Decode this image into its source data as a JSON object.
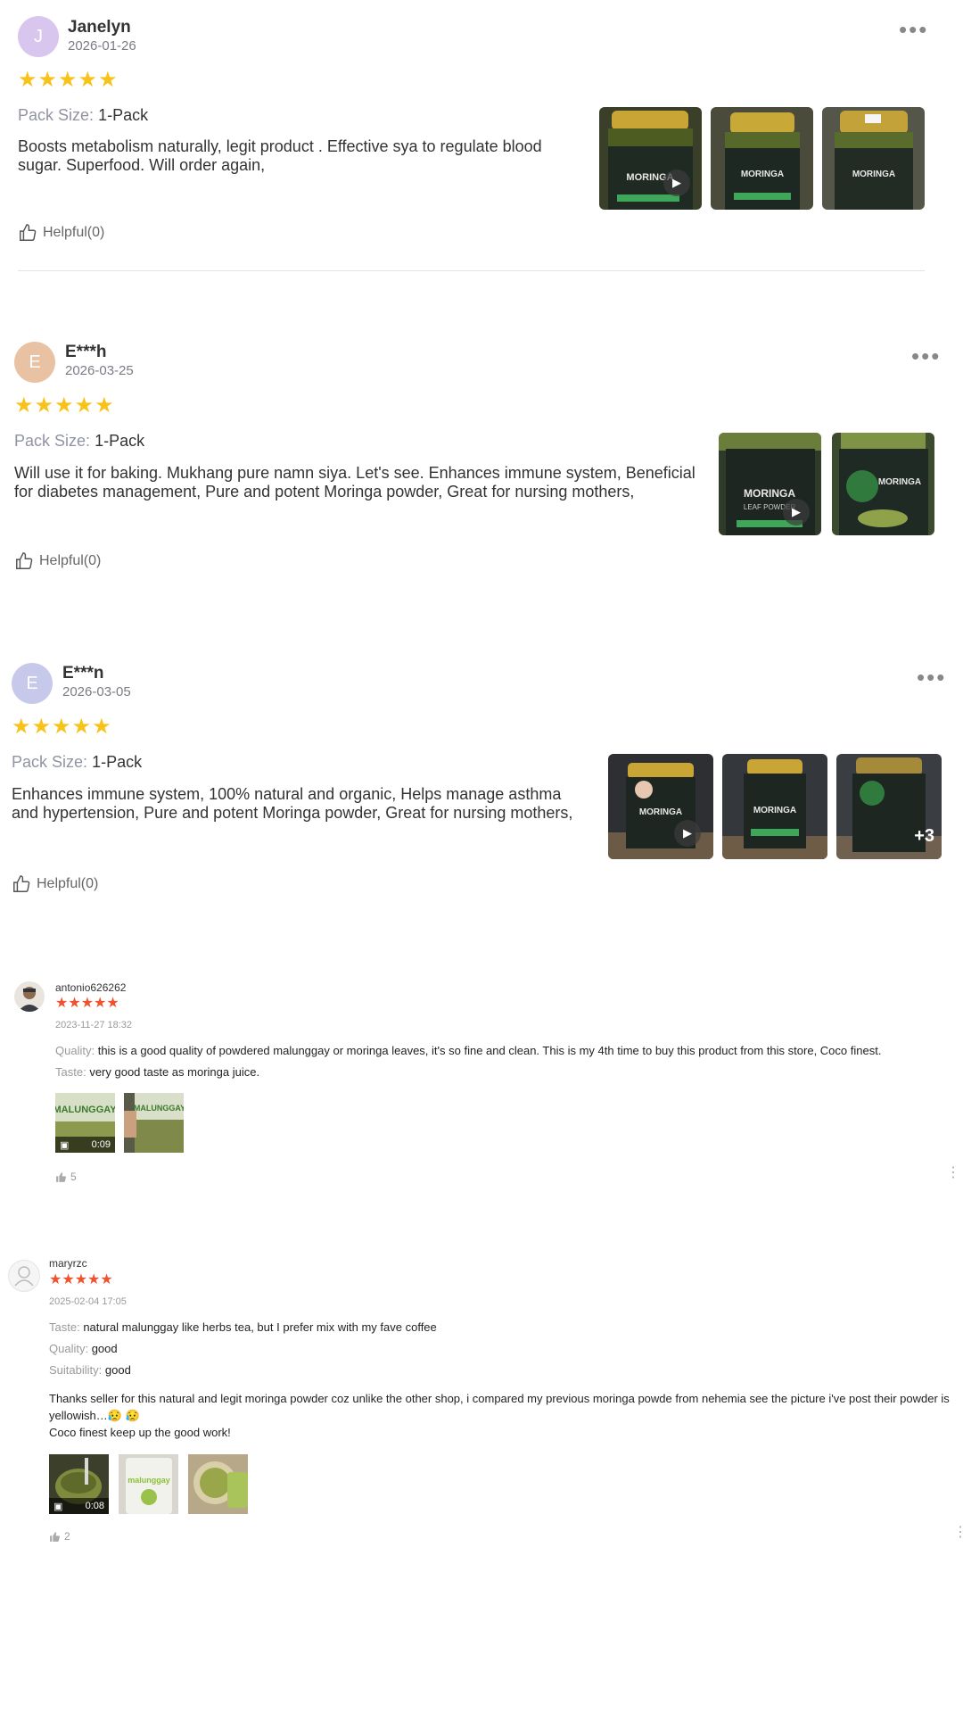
{
  "reviews_a": [
    {
      "initial": "J",
      "avatar_color": "#d8c6ee",
      "name": "Janelyn",
      "date": "2026-01-26",
      "stars": "★★★★★",
      "pack_label": "Pack Size:",
      "pack_value": "1-Pack",
      "text": "Boosts metabolism naturally, legit product . Effective sya to regulate blood sugar. Superfood. Will order again,",
      "helpful": "Helpful(0)",
      "more": "•••"
    },
    {
      "initial": "E",
      "avatar_color": "#e9c2a3",
      "name": "E***h",
      "date": "2026-03-25",
      "stars": "★★★★★",
      "pack_label": "Pack Size:",
      "pack_value": "1-Pack",
      "text": "Will use it for baking. Mukhang pure namn siya. Let's see. Enhances immune system, Beneficial for diabetes management, Pure and potent Moringa powder, Great for nursing mothers,",
      "helpful": "Helpful(0)",
      "more": "•••"
    },
    {
      "initial": "E",
      "avatar_color": "#c7c9ea",
      "name": "E***n",
      "date": "2026-03-05",
      "stars": "★★★★★",
      "pack_label": "Pack Size:",
      "pack_value": "1-Pack",
      "text": "Enhances immune system, 100% natural and organic, Helps manage asthma and hypertension, Pure and potent Moringa powder, Great for nursing mothers,",
      "helpful": "Helpful(0)",
      "more": "•••",
      "more_photos": "+3"
    }
  ],
  "reviews_b": [
    {
      "name": "antonio626262",
      "stars": "★★★★★",
      "date": "2023-11-27 18:32",
      "lines": [
        {
          "label": "Quality:",
          "value": "this is a good quality of powdered malunggay or moringa leaves, it's so fine and clean. This is my 4th time to buy this product from this store, Coco finest."
        },
        {
          "label": "Taste:",
          "value": "very good taste as moringa juice."
        }
      ],
      "video_duration": "0:09",
      "likes": "5"
    },
    {
      "name": "maryrzc",
      "stars": "★★★★★",
      "date": "2025-02-04 17:05",
      "lines": [
        {
          "label": "Taste:",
          "value": "natural malunggay like herbs tea, but I prefer mix with my fave coffee"
        },
        {
          "label": "Quality:",
          "value": "good"
        },
        {
          "label": "Suitability:",
          "value": "good"
        }
      ],
      "body1": "Thanks seller for this natural and legit moringa powder coz unlike the other shop, i compared my previous moringa powde from nehemia see the picture i've post their powder is yellowish…😥 😥",
      "body2": "Coco finest keep up the good work!",
      "video_duration": "0:08",
      "likes": "2"
    }
  ],
  "thumb_labels": {
    "jar_title": "MORINGA",
    "jar_sub": "LEAF POWDER",
    "bag_title": "MALUNGGAY",
    "bag_title_lower": "malunggay"
  },
  "icons": {
    "thumb_up": "thumbs-up-outline",
    "play": "play-icon",
    "video": "video-camera-icon",
    "more": "more-horizontal",
    "more_vertical": "more-vertical"
  },
  "colors": {
    "star_gold": "#f7c31a",
    "star_red": "#f0512e",
    "label_gray": "#9094a3"
  }
}
